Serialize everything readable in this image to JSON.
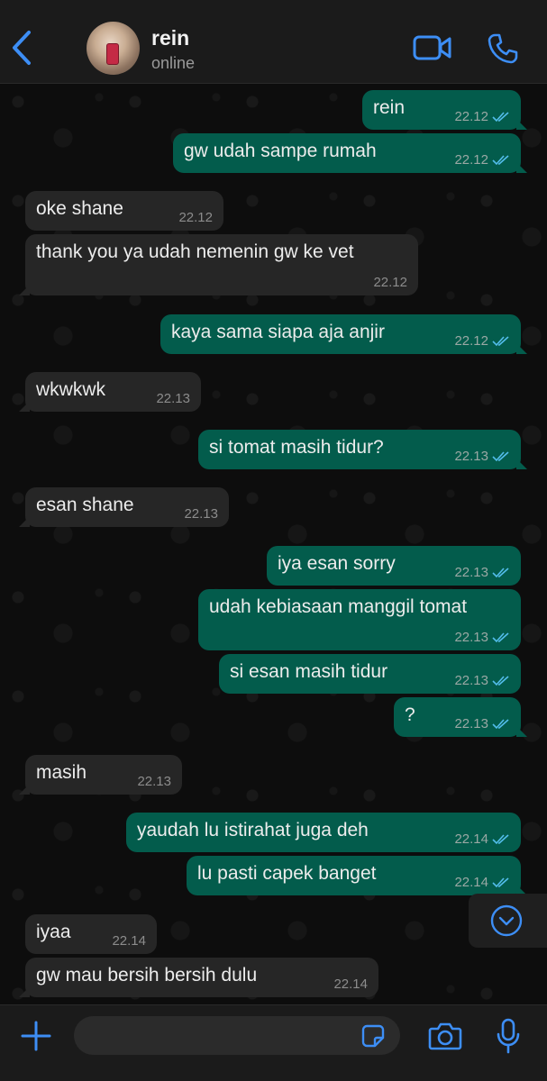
{
  "header": {
    "contact_name": "rein",
    "status": "online"
  },
  "colors": {
    "accent": "#3d8ef5",
    "outgoing_bubble": "#035c4c",
    "incoming_bubble": "#262626",
    "read_tick": "#53bdeb"
  },
  "icons": {
    "back": "chevron-left-icon",
    "video": "video-call-icon",
    "call": "phone-icon",
    "scroll": "chevron-down-circle-icon",
    "plus": "plus-icon",
    "sticker": "sticker-icon",
    "camera": "camera-icon",
    "mic": "microphone-icon"
  },
  "messages": [
    {
      "dir": "out",
      "text": "rein",
      "time": "22.12",
      "read": true
    },
    {
      "dir": "out",
      "text": "gw udah sampe rumah",
      "time": "22.12",
      "read": true
    },
    {
      "dir": "in",
      "text": "oke shane",
      "time": "22.12"
    },
    {
      "dir": "in",
      "text": "thank you ya udah nemenin gw ke vet",
      "time": "22.12"
    },
    {
      "dir": "out",
      "text": "kaya sama siapa aja anjir",
      "time": "22.12",
      "read": true
    },
    {
      "dir": "in",
      "text": "wkwkwk",
      "time": "22.13"
    },
    {
      "dir": "out",
      "text": "si tomat masih tidur?",
      "time": "22.13",
      "read": true
    },
    {
      "dir": "in",
      "text": "esan shane",
      "time": "22.13"
    },
    {
      "dir": "out",
      "text": "iya esan sorry",
      "time": "22.13",
      "read": true
    },
    {
      "dir": "out",
      "text": "udah kebiasaan manggil tomat",
      "time": "22.13",
      "read": true
    },
    {
      "dir": "out",
      "text": "si esan masih tidur",
      "time": "22.13",
      "read": true
    },
    {
      "dir": "out",
      "text": "?",
      "time": "22.13",
      "read": true
    },
    {
      "dir": "in",
      "text": "masih",
      "time": "22.13"
    },
    {
      "dir": "out",
      "text": "yaudah lu istirahat juga deh",
      "time": "22.14",
      "read": true
    },
    {
      "dir": "out",
      "text": "lu pasti capek banget",
      "time": "22.14",
      "read": true
    },
    {
      "dir": "in",
      "text": "iyaa",
      "time": "22.14"
    },
    {
      "dir": "in",
      "text": "gw mau bersih bersih dulu",
      "time": "22.14"
    }
  ],
  "composer": {
    "value": "",
    "placeholder": ""
  }
}
